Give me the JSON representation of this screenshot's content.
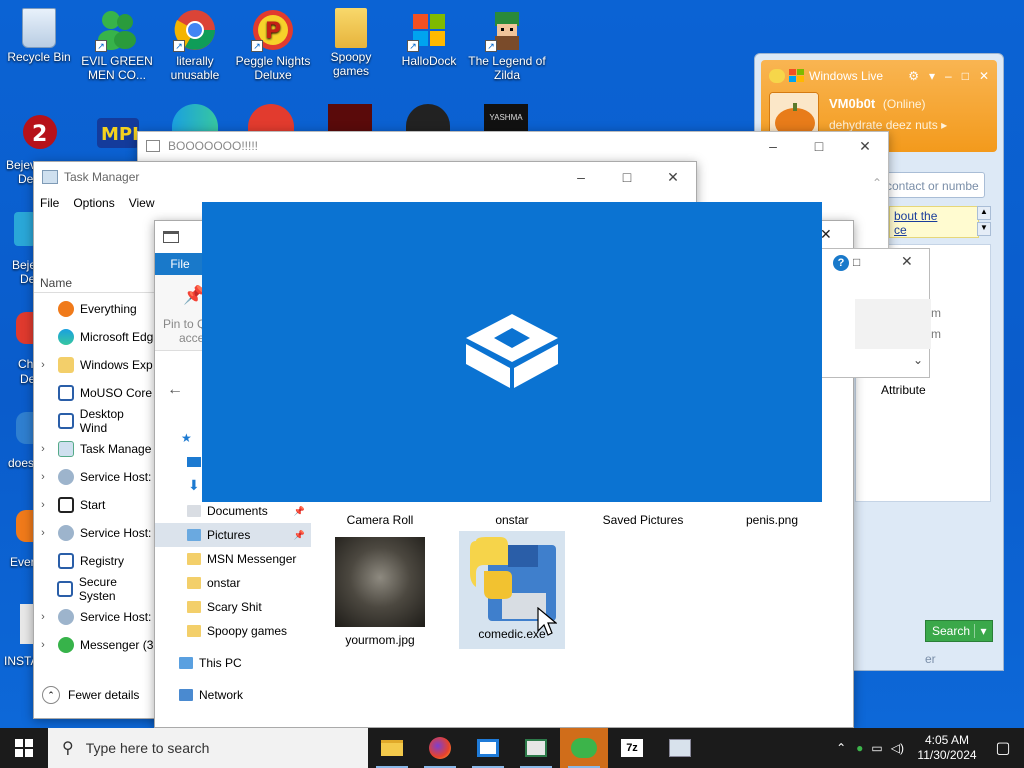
{
  "desktop": {
    "icons_row1": [
      {
        "label": "Recycle Bin",
        "icon": "recycle-bin-icon"
      },
      {
        "label": "EVIL GREEN MEN CO...",
        "icon": "msn-people-icon"
      },
      {
        "label": "literally unusable",
        "icon": "chrome-icon"
      },
      {
        "label": "Peggle Nights Deluxe",
        "icon": "peggle-icon"
      },
      {
        "label": "Spoopy games",
        "icon": "folder-icon"
      },
      {
        "label": "HalloDock",
        "icon": "windows-flag-icon"
      },
      {
        "label": "The Legend of Zilda",
        "icon": "zilda-icon"
      }
    ],
    "partial_labels": [
      "Bejev",
      "Del",
      "Beje",
      "De",
      "Ch",
      "De",
      "does",
      "Ever",
      "INSTA"
    ]
  },
  "boo_window": {
    "title": "BOOOOOOO!!!!!"
  },
  "task_manager": {
    "title": "Task Manager",
    "menu": [
      "File",
      "Options",
      "View"
    ],
    "column_name": "Name",
    "processes": [
      {
        "name": "Everything",
        "expand": ""
      },
      {
        "name": "Microsoft Edg",
        "expand": ""
      },
      {
        "name": "Windows Exp",
        "expand": "›"
      },
      {
        "name": "MoUSO Core",
        "expand": ""
      },
      {
        "name": "Desktop Wind",
        "expand": ""
      },
      {
        "name": "Task Manage",
        "expand": "›"
      },
      {
        "name": "Service Host:",
        "expand": "›"
      },
      {
        "name": "Start",
        "expand": "›"
      },
      {
        "name": "Service Host:",
        "expand": "›"
      },
      {
        "name": "Registry",
        "expand": ""
      },
      {
        "name": "Secure Systen",
        "expand": ""
      },
      {
        "name": "Service Host:",
        "expand": "›"
      },
      {
        "name": "Messenger (3",
        "expand": "›"
      }
    ],
    "fewer_details": "Fewer details"
  },
  "explorer": {
    "file_tab": "File",
    "pin_label_1": "Pin to Q",
    "pin_label_2": "acce",
    "nav_items": [
      "Documents",
      "Pictures",
      "MSN Messenger",
      "onstar",
      "Scary Shit",
      "Spoopy games"
    ],
    "this_pc": "This PC",
    "network": "Network",
    "top_files": [
      "Camera Roll",
      "onstar",
      "Saved Pictures",
      "penis.png"
    ],
    "files": [
      {
        "name": "yourmom.jpg"
      },
      {
        "name": "comedic.exe"
      }
    ],
    "attributes_header": "Attribute",
    "help_glyph": "?"
  },
  "msn": {
    "title": "Windows Live",
    "username": "VM0b0t",
    "status": "(Online)",
    "personal_message": "dehydrate deez nuts",
    "search_placeholder": "contact or numbe",
    "link_text_1": "bout the",
    "link_text_2": "ce",
    "search_button": "Search",
    "side_text_1": "m",
    "side_text_2": "m"
  },
  "taskbar": {
    "search_placeholder": "Type here to search",
    "time": "4:05 AM",
    "date": "11/30/2024",
    "pinned": [
      "file-explorer-icon",
      "firefox-icon",
      "sandbox-icon",
      "app-window-icon",
      "messenger-icon",
      "7zip-icon",
      "cloud-app-icon"
    ],
    "active_index": 4
  },
  "colors": {
    "desktop": "#0b63d4",
    "splash": "#0b73d2",
    "msn_orange": "#f6a12f",
    "taskbar": "#1b1b1b"
  }
}
